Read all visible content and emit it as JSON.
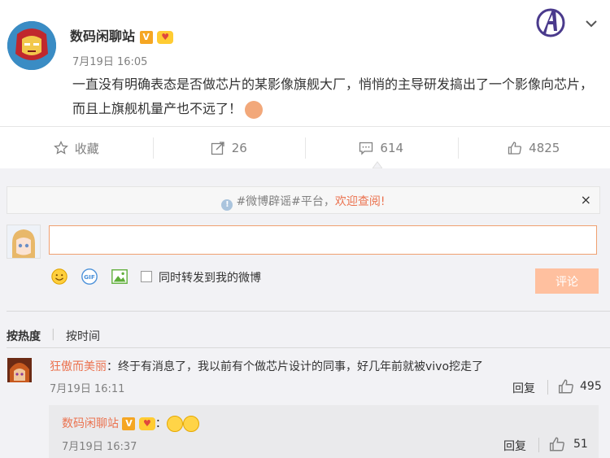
{
  "post": {
    "author": "数码闲聊站",
    "verified_badge": "V",
    "time": "7月19日 16:05",
    "text": "一直没有明确表态是否做芯片的某影像旗舰大厂，悄悄的主导研发搞出了一个影像向芯片，而且上旗舰机量产也不远了！"
  },
  "actions": {
    "favorite": "收藏",
    "repost_count": "26",
    "comment_count": "614",
    "like_count": "4825"
  },
  "notice": {
    "text_before": "#微博辟谣#平台，",
    "text_highlight": "欢迎查阅!",
    "close": "×"
  },
  "composer": {
    "input_value": "",
    "repost_label": "同时转发到我的微博",
    "submit_label": "评论"
  },
  "sort": {
    "hot": "按热度",
    "separator": "|",
    "time": "按时间"
  },
  "comments": [
    {
      "user": "狂傲而美丽",
      "text": "：终于有消息了，我以前有个做芯片设计的同事，好几年前就被vivo挖走了",
      "time": "7月19日 16:11",
      "reply_label": "回复",
      "likes": "495",
      "reply": {
        "user": "数码闲聊站",
        "badge": "V",
        "text": "：",
        "time": "7月19日 16:37",
        "reply_label": "回复",
        "likes": "51"
      }
    }
  ],
  "colors": {
    "accent": "#eb7350",
    "submit_bg": "#ffc09f",
    "panel_bg": "#f2f2f5",
    "verified": "#f5a623"
  },
  "icons": [
    "star-icon",
    "repost-icon",
    "comment-icon",
    "like-icon",
    "avengers-icon",
    "chevron-down-icon",
    "smiley-icon",
    "gif-icon",
    "image-icon",
    "close-icon",
    "info-icon"
  ]
}
